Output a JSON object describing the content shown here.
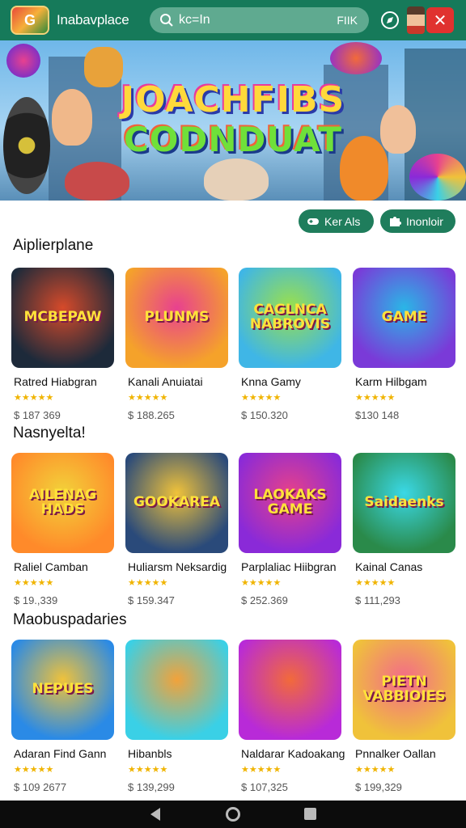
{
  "header": {
    "logo_text": "G",
    "title": "Inabavplace",
    "search_value": "kc=In",
    "search_right": "FIIK",
    "close_symbol": "✕"
  },
  "hero": {
    "line1": "JOACHFIBS",
    "line2": "CODNDUAT"
  },
  "chips": [
    {
      "label": "Ker Als",
      "icon": "gamepad-icon"
    },
    {
      "label": "Inonloir",
      "icon": "puzzle-icon"
    }
  ],
  "sections": [
    {
      "title": "Aiplierplane",
      "cards": [
        {
          "art": "MCBEPAW",
          "name": "Ratred Hiabgran",
          "stars": "★★★★★",
          "price": "$ 187 369",
          "colors": [
            "#1d2a3a",
            "#d64a2a"
          ]
        },
        {
          "art": "PLUNMS",
          "name": "Kanali Anuiatai",
          "stars": "★★★★★",
          "price": "$ 188.265",
          "colors": [
            "#f5a22a",
            "#e8418f"
          ]
        },
        {
          "art": "CAGLNCA NABROVIS",
          "name": "Knna Gamy",
          "stars": "★★★★★",
          "price": "$ 150.320",
          "colors": [
            "#3fb6e6",
            "#9be04a"
          ]
        },
        {
          "art": "GAME",
          "name": "Karm Hilbgam",
          "stars": "★★★★★",
          "price": "$130 148",
          "colors": [
            "#7a3ad8",
            "#2ab6e6"
          ]
        }
      ]
    },
    {
      "title": "Nasnyelta!",
      "cards": [
        {
          "art": "AILENAG HADS",
          "name": "Raliel Camban",
          "stars": "★★★★★",
          "price": "$ 19.,339",
          "colors": [
            "#ff8a2a",
            "#f2d23a"
          ]
        },
        {
          "art": "GOOKAREA",
          "name": "Huliarsm Neksardig",
          "stars": "★★★★★",
          "price": "$ 159.347",
          "colors": [
            "#2a4a7a",
            "#f0c23a"
          ]
        },
        {
          "art": "LAOKAKS GAME",
          "name": "Parplaliac Hiibgran",
          "stars": "★★★★★",
          "price": "$ 252.369",
          "colors": [
            "#8a2ad8",
            "#e6418a"
          ]
        },
        {
          "art": "Saidaenks",
          "name": "Kainal Canas",
          "stars": "★★★★★",
          "price": "$ 111,293",
          "colors": [
            "#2a8a4a",
            "#3ad8e6"
          ]
        }
      ]
    },
    {
      "title": "Maobuspadaries",
      "cards": [
        {
          "art": "NEPUES",
          "name": "Adaran Find Gann",
          "stars": "★★★★★",
          "price": "$ 109 2677",
          "colors": [
            "#2a8ae6",
            "#f0c23a"
          ]
        },
        {
          "art": "",
          "name": "Hibanbls",
          "stars": "★★★★★",
          "price": "$ 139,299",
          "colors": [
            "#3ad0e6",
            "#f2a23a"
          ]
        },
        {
          "art": "",
          "name": "Naldarar Kadoakang",
          "stars": "★★★★★",
          "price": "$ 107,325",
          "colors": [
            "#b82ad8",
            "#f26a3a"
          ]
        },
        {
          "art": "PIETN VABBIOIES",
          "name": "Pnnalker Oallan",
          "stars": "★★★★★",
          "price": "$ 199,329",
          "colors": [
            "#f0c23a",
            "#f26a8a"
          ]
        }
      ]
    }
  ],
  "colors": {
    "brand": "#167a5a",
    "accent": "#1f7d5c",
    "close": "#e0322f",
    "stars": "#f0b400"
  }
}
